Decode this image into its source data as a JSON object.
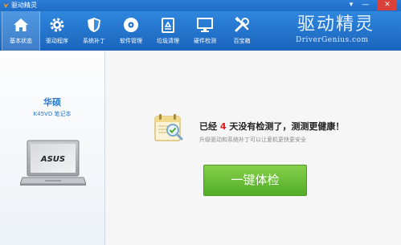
{
  "window": {
    "title": "驱动精灵"
  },
  "window_controls": {
    "menu": "▾",
    "minimize": "—",
    "close": "✕"
  },
  "toolbar": {
    "items": [
      {
        "label": "基本状态",
        "icon": "home-icon"
      },
      {
        "label": "驱动程序",
        "icon": "gear-icon"
      },
      {
        "label": "系统补丁",
        "icon": "shield-icon"
      },
      {
        "label": "软件管理",
        "icon": "disc-icon"
      },
      {
        "label": "垃圾清理",
        "icon": "trash-icon"
      },
      {
        "label": "硬件检测",
        "icon": "monitor-icon"
      },
      {
        "label": "百宝箱",
        "icon": "tools-icon"
      }
    ],
    "active_index": 0
  },
  "brand": {
    "cn": "驱动精灵",
    "en": "DriverGenius.com"
  },
  "device": {
    "brand": "华硕",
    "model": "K45VD 笔记本",
    "laptop_logo": "ASUS"
  },
  "status": {
    "prefix": "已经",
    "days": "4",
    "suffix": "天没有检测了，测测更健康！",
    "hint": "升级驱动和系统补丁可以让爱机更快更安全"
  },
  "actions": {
    "check_button": "一键体检"
  },
  "colors": {
    "toolbar": "#1e6bc4",
    "accent_red": "#e11b1b",
    "button_green": "#5fb52f",
    "brand_blue": "#2a76c9"
  }
}
